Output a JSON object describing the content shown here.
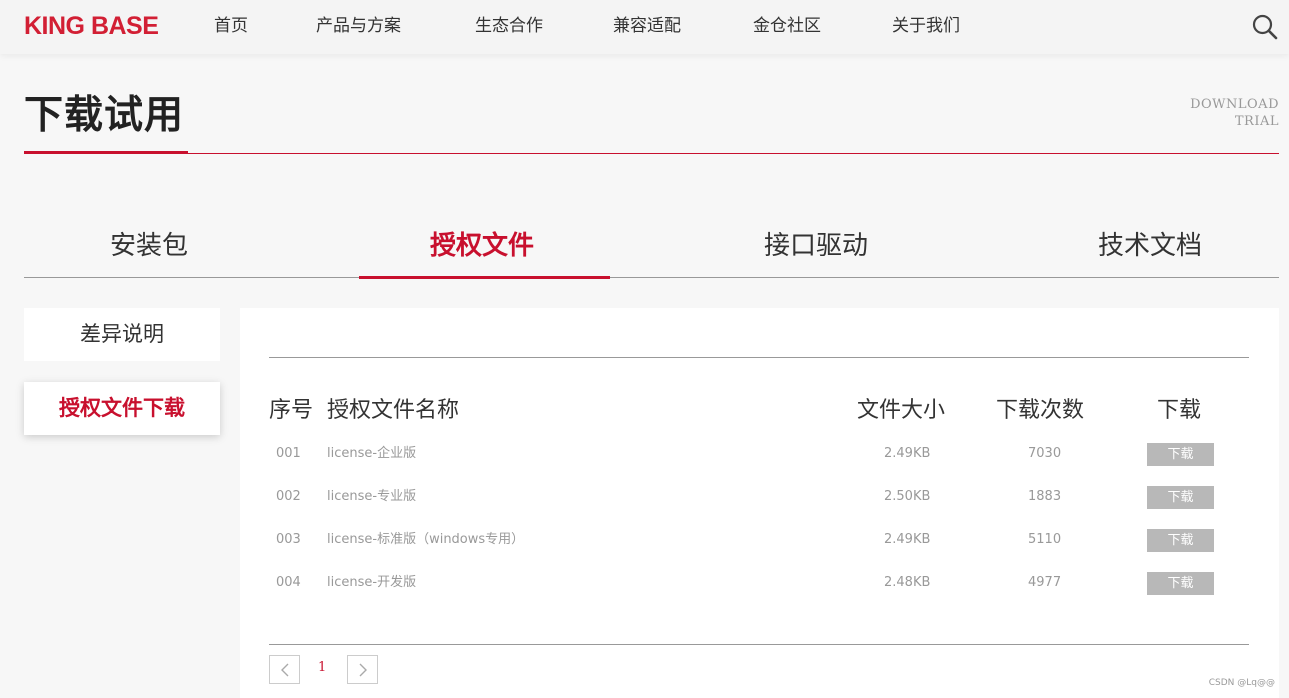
{
  "header": {
    "logo": "KING BASE",
    "nav": [
      "首页",
      "产品与方案",
      "生态合作",
      "兼容适配",
      "金仓社区",
      "关于我们"
    ],
    "search_icon": "search-icon"
  },
  "page": {
    "title": "下载试用",
    "title_en_line1": "DOWNLOAD",
    "title_en_line2": "TRIAL"
  },
  "tabs": [
    {
      "label": "安装包",
      "active": false
    },
    {
      "label": "授权文件",
      "active": true
    },
    {
      "label": "接口驱动",
      "active": false
    },
    {
      "label": "技术文档",
      "active": false
    }
  ],
  "side_menu": [
    {
      "label": "差异说明",
      "active": false
    },
    {
      "label": "授权文件下载",
      "active": true
    }
  ],
  "table": {
    "headers": {
      "index": "序号",
      "name": "授权文件名称",
      "size": "文件大小",
      "count": "下载次数",
      "download": "下载"
    },
    "rows": [
      {
        "index": "001",
        "name": "license-企业版",
        "size": "2.49KB",
        "count": "7030",
        "button": "下载"
      },
      {
        "index": "002",
        "name": "license-专业版",
        "size": "2.50KB",
        "count": "1883",
        "button": "下载"
      },
      {
        "index": "003",
        "name": "license-标准版（windows专用）",
        "size": "2.49KB",
        "count": "5110",
        "button": "下载"
      },
      {
        "index": "004",
        "name": "license-开发版",
        "size": "2.48KB",
        "count": "4977",
        "button": "下载"
      }
    ]
  },
  "pagination": {
    "current_page": "1",
    "prev_icon": "chevron-left-icon",
    "next_icon": "chevron-right-icon"
  },
  "watermark": "CSDN @Lq@@",
  "colors": {
    "accent": "#c8102e",
    "button_gray": "#b8b8b8"
  }
}
